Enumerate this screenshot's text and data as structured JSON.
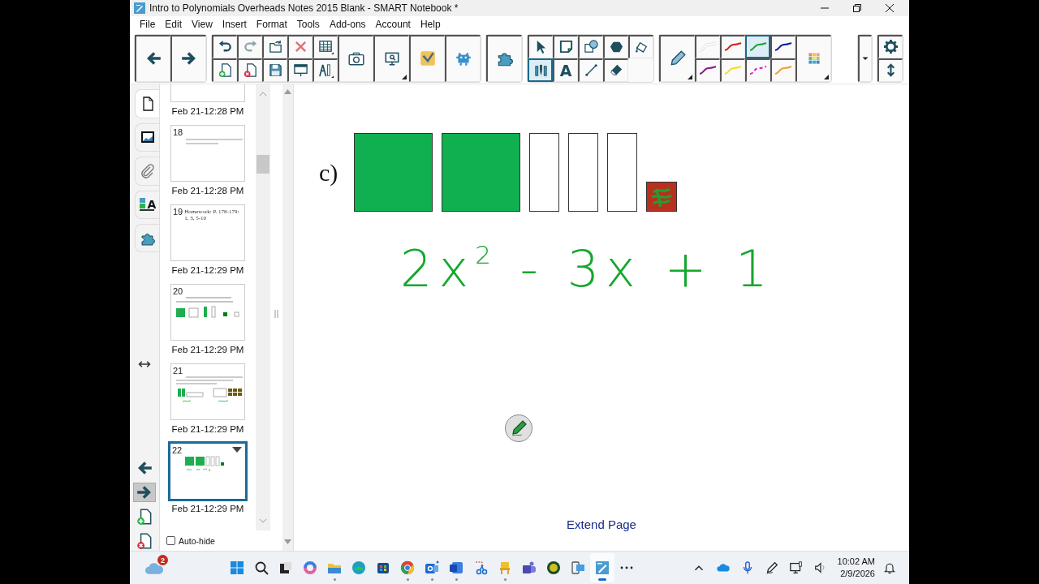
{
  "window": {
    "title": "Intro to Polynomials Overheads Notes 2015 Blank - SMART Notebook *"
  },
  "menu": [
    "File",
    "Edit",
    "View",
    "Insert",
    "Format",
    "Tools",
    "Add-ons",
    "Account",
    "Help"
  ],
  "toolbar": {
    "groups": [
      {
        "items": [
          {
            "kind": "back"
          },
          {
            "kind": "forward"
          }
        ]
      },
      {
        "items": [
          {
            "kind": "undo"
          },
          {
            "kind": "add_page"
          },
          {
            "kind": "redo"
          },
          {
            "kind": "delete_page"
          },
          {
            "kind": "open"
          },
          {
            "kind": "save"
          },
          {
            "kind": "delete"
          },
          {
            "kind": "screen_shade"
          },
          {
            "kind": "table"
          },
          {
            "kind": "measure"
          },
          {
            "kind": "camera"
          },
          {
            "kind": "doc_camera"
          },
          {
            "kind": "response"
          },
          {
            "kind": "addon"
          }
        ]
      },
      {
        "items": [
          {
            "kind": "puzzle"
          }
        ]
      },
      {
        "items": [
          {
            "kind": "select",
            "selected": false
          },
          {
            "kind": "pens",
            "selected": true
          },
          {
            "kind": "note",
            "selected": false
          },
          {
            "kind": "text",
            "label": "A",
            "selected": false
          },
          {
            "kind": "shapes",
            "selected": false
          },
          {
            "kind": "line",
            "selected": false
          },
          {
            "kind": "polygon",
            "selected": false
          },
          {
            "kind": "eraser",
            "selected": false
          },
          {
            "kind": "fill",
            "selected": false
          }
        ]
      },
      {
        "items": [
          {
            "kind": "pencil"
          },
          {
            "kind": "pen",
            "color": "#ffffff",
            "selected": false
          },
          {
            "kind": "pen",
            "color": "#8b1a8b",
            "selected": false
          },
          {
            "kind": "pen",
            "color": "#d42020",
            "selected": false
          },
          {
            "kind": "pen",
            "color": "#f0e030",
            "selected": false
          },
          {
            "kind": "pen",
            "color": "#20a030",
            "selected": true
          },
          {
            "kind": "dash_pen",
            "color": "#e020c0",
            "selected": false
          },
          {
            "kind": "pen",
            "color": "#1a1aa0",
            "selected": false
          },
          {
            "kind": "pen",
            "color": "#f0a030",
            "selected": false
          },
          {
            "kind": "palette"
          }
        ]
      },
      {
        "items": [
          {
            "kind": "dropdown"
          }
        ]
      },
      {
        "items": [
          {
            "kind": "gear"
          },
          {
            "kind": "updown"
          }
        ]
      }
    ]
  },
  "side_tabs": [
    {
      "kind": "pages",
      "selected": true
    },
    {
      "kind": "gallery",
      "selected": false
    },
    {
      "kind": "attachments",
      "selected": false
    },
    {
      "kind": "properties",
      "label": "A",
      "selected": false
    },
    {
      "kind": "addons",
      "selected": false
    }
  ],
  "page_nav": [
    {
      "kind": "resize",
      "highlighted": false
    },
    {
      "kind": "previous",
      "highlighted": false
    },
    {
      "kind": "next",
      "highlighted": true
    },
    {
      "kind": "add_page",
      "highlighted": false
    },
    {
      "kind": "delete_page",
      "highlighted": false
    }
  ],
  "pages": [
    {
      "kind": "cut",
      "date": "Feb 21-12:28 PM",
      "selected": false
    },
    {
      "number": "18",
      "kind": "text",
      "date": "Feb 21-12:28 PM",
      "selected": false
    },
    {
      "number": "19",
      "kind": "caption",
      "caption": "Homework: P. 178-179: 1, 3, 5-10",
      "date": "Feb 21-12:29 PM",
      "selected": false
    },
    {
      "number": "20",
      "kind": "tiles",
      "date": "Feb 21-12:29 PM",
      "selected": false
    },
    {
      "number": "21",
      "kind": "expressions",
      "date": "Feb 21-12:29 PM",
      "selected": false
    },
    {
      "number": "22",
      "kind": "tiles_ink",
      "date": "Feb 21-12:29 PM",
      "selected": true
    }
  ],
  "auto_hide": {
    "label": "Auto-hide",
    "checked": false
  },
  "canvas": {
    "label": "c)",
    "tiles": [
      {
        "kind": "x_squared"
      },
      {
        "kind": "x_squared"
      },
      {
        "kind": "x"
      },
      {
        "kind": "x"
      },
      {
        "kind": "x"
      },
      {
        "kind": "unit"
      }
    ],
    "ink": "2x$^{2}$ - 3x + 1",
    "extend_page": "Extend Page"
  },
  "taskbar": {
    "weather_badge": "2",
    "apps": [
      {
        "kind": "start",
        "running": false,
        "active": false
      },
      {
        "kind": "search",
        "running": false,
        "active": false
      },
      {
        "kind": "task_view",
        "running": false,
        "active": false
      },
      {
        "kind": "swirl",
        "running": false,
        "active": false
      },
      {
        "kind": "folder",
        "running": true,
        "active": false
      },
      {
        "kind": "wave",
        "running": false,
        "active": false
      },
      {
        "kind": "bag",
        "running": false,
        "active": false
      },
      {
        "kind": "ring",
        "running": true,
        "active": false
      },
      {
        "kind": "mail",
        "running": true,
        "active": false
      },
      {
        "kind": "doc",
        "running": true,
        "active": false
      },
      {
        "kind": "scissors",
        "running": false,
        "active": false
      },
      {
        "kind": "chair",
        "running": true,
        "active": false
      },
      {
        "kind": "people",
        "running": false,
        "active": false
      },
      {
        "kind": "circle",
        "running": false,
        "active": false
      },
      {
        "kind": "phone",
        "running": false,
        "active": false
      },
      {
        "kind": "notebook",
        "running": true,
        "active": true
      },
      {
        "kind": "more",
        "running": false,
        "active": false
      }
    ],
    "tray": [
      {
        "kind": "chevron"
      },
      {
        "kind": "cloud"
      },
      {
        "kind": "mic"
      },
      {
        "kind": "pen"
      },
      {
        "kind": "monitor"
      },
      {
        "kind": "speaker"
      }
    ],
    "time": "10:02 AM",
    "date": "2/9/2026"
  }
}
